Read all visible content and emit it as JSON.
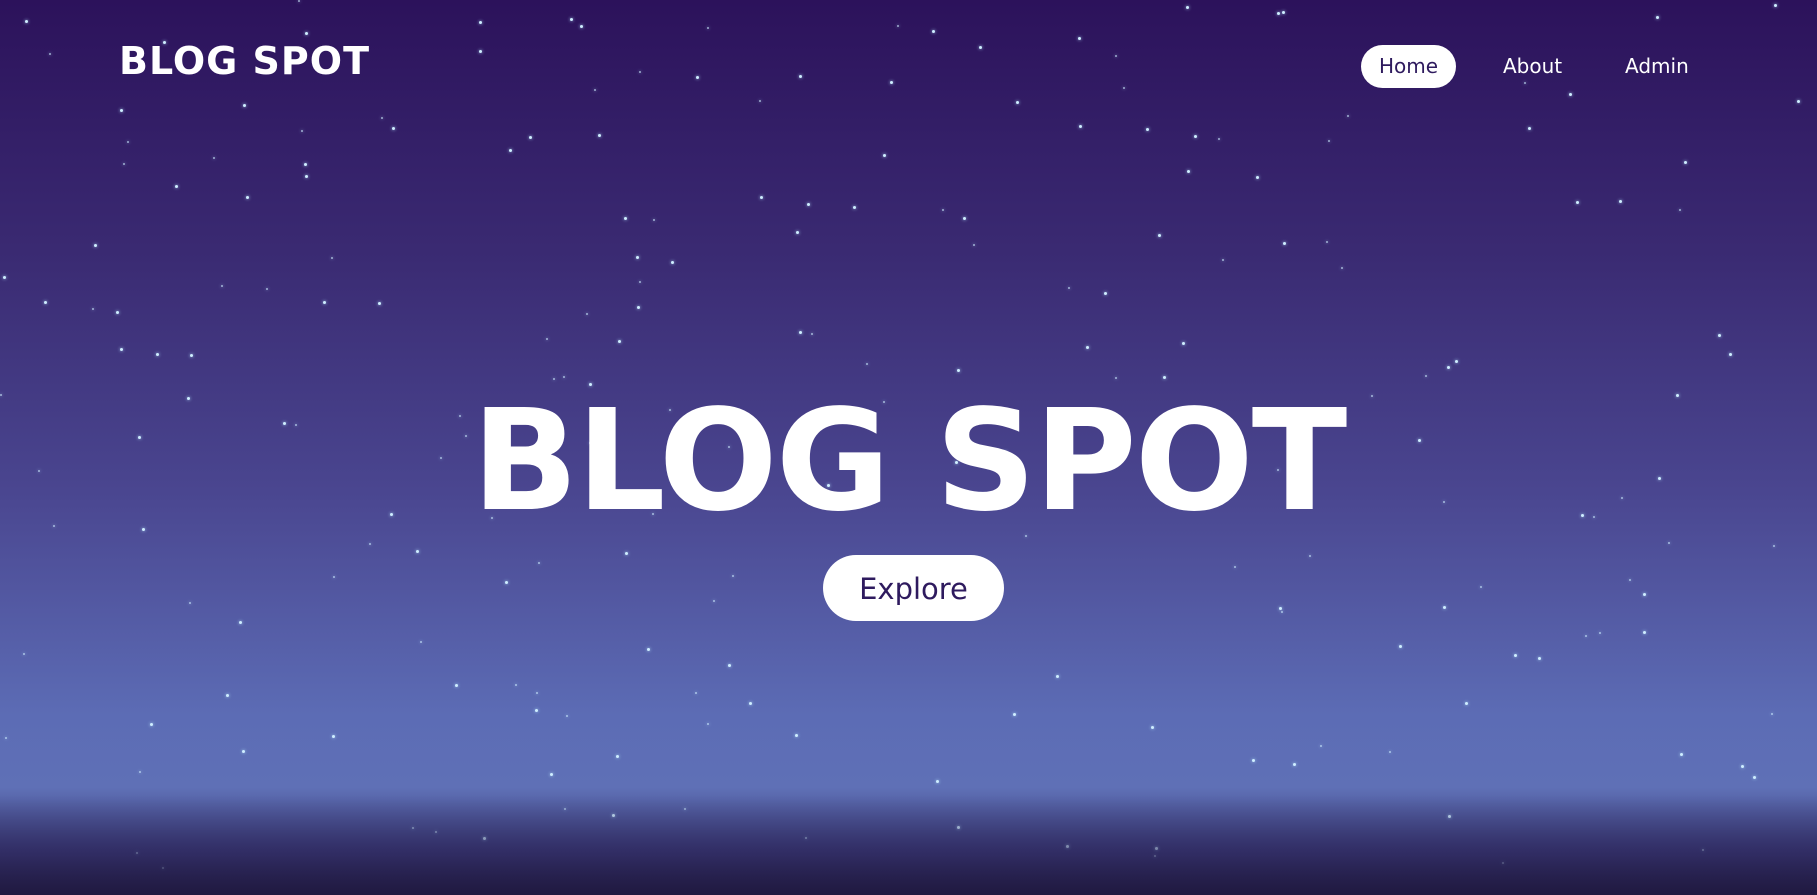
{
  "header": {
    "logo": "BLOG SPOT"
  },
  "nav": {
    "items": [
      {
        "label": "Home",
        "active": true
      },
      {
        "label": "About",
        "active": false
      },
      {
        "label": "Admin",
        "active": false
      }
    ]
  },
  "hero": {
    "title": "BLOG SPOT",
    "button_label": "Explore"
  },
  "colors": {
    "sky_top": "#2c125b",
    "sky_bottom": "#5f70b6",
    "accent_text": "#2e1a5e",
    "white": "#ffffff"
  }
}
